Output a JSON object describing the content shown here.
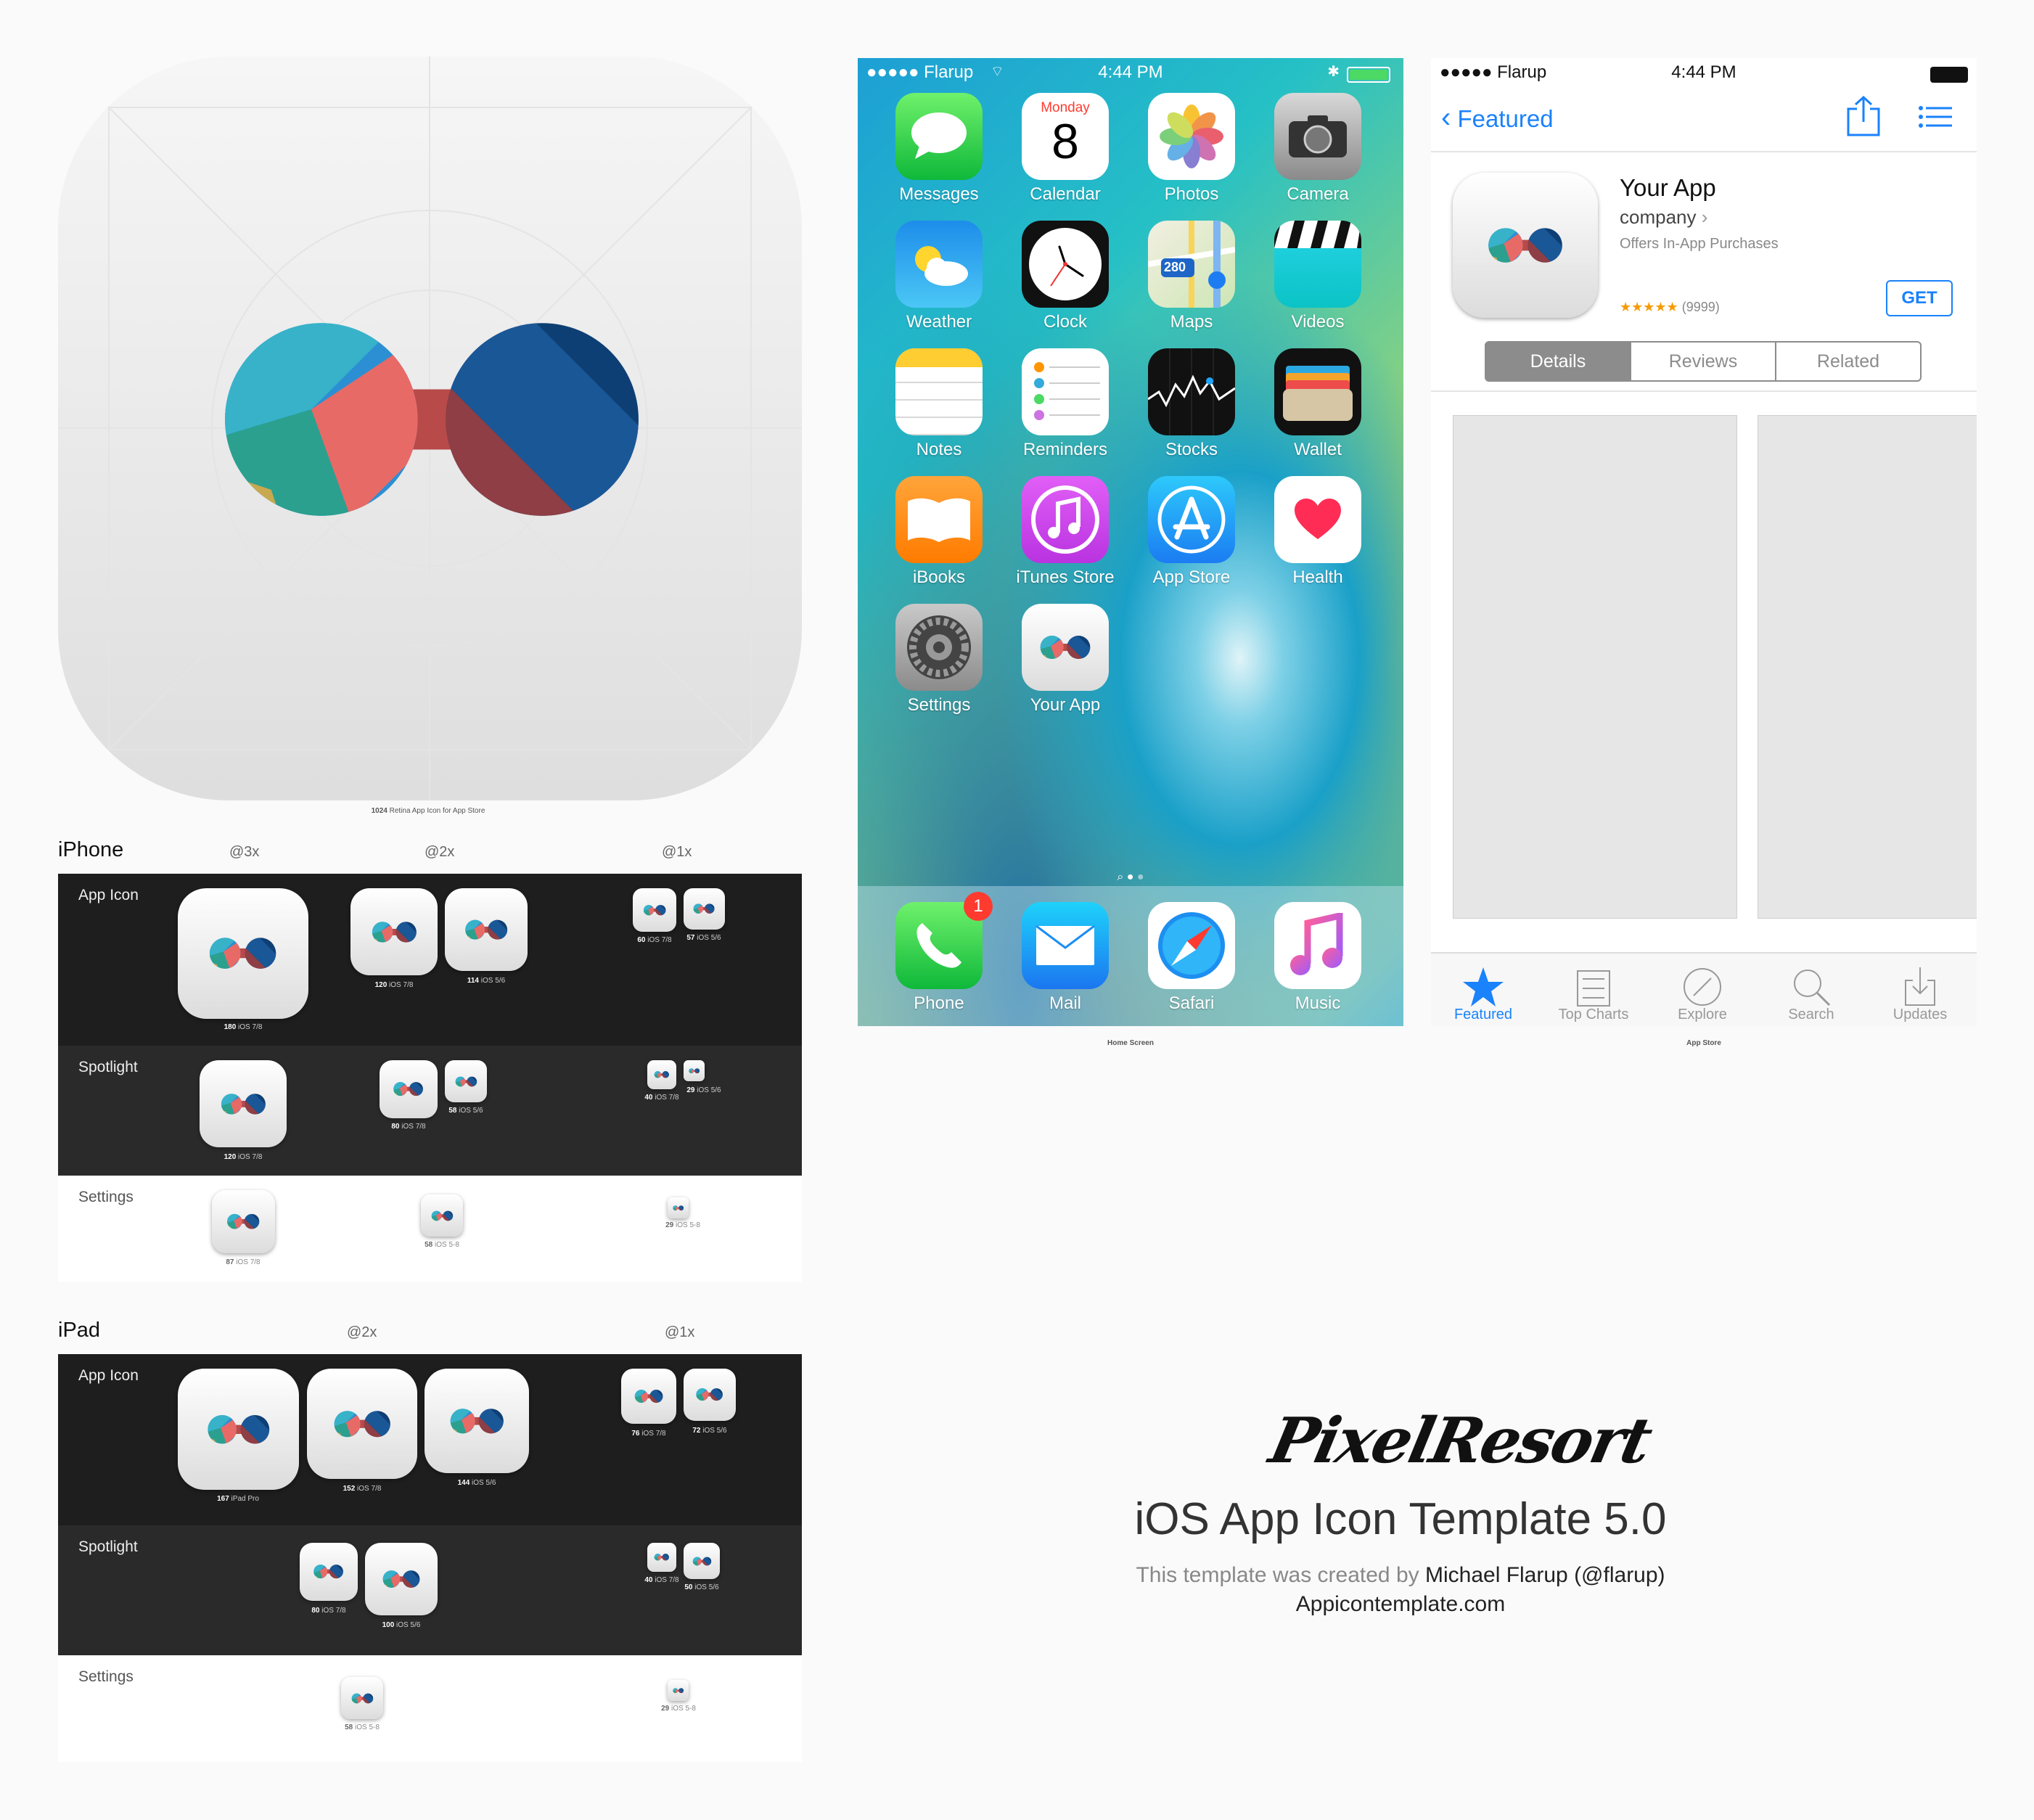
{
  "big_icon": {
    "caption_size": "1024",
    "caption_text": "Retina App Icon for App Store"
  },
  "iphone": {
    "title": "iPhone",
    "columns": [
      "@3x",
      "@2x",
      "@1x"
    ],
    "rows": [
      {
        "label": "App Icon",
        "items": [
          {
            "size": "180",
            "ver": "iOS 7/8"
          },
          {
            "size": "120",
            "ver": "iOS 7/8"
          },
          {
            "size": "114",
            "ver": "iOS 5/6"
          },
          {
            "size": "60",
            "ver": "iOS 7/8"
          },
          {
            "size": "57",
            "ver": "iOS 5/6"
          }
        ]
      },
      {
        "label": "Spotlight",
        "items": [
          {
            "size": "120",
            "ver": "iOS 7/8"
          },
          {
            "size": "80",
            "ver": "iOS 7/8"
          },
          {
            "size": "58",
            "ver": "iOS 5/6"
          },
          {
            "size": "40",
            "ver": "iOS 7/8"
          },
          {
            "size": "29",
            "ver": "iOS 5/6"
          }
        ]
      },
      {
        "label": "Settings",
        "items": [
          {
            "size": "87",
            "ver": "iOS 7/8"
          },
          {
            "size": "58",
            "ver": "iOS 5-8"
          },
          {
            "size": "29",
            "ver": "iOS 5-8"
          }
        ]
      }
    ]
  },
  "ipad": {
    "title": "iPad",
    "columns": [
      "@2x",
      "@1x"
    ],
    "rows": [
      {
        "label": "App Icon",
        "items": [
          {
            "size": "167",
            "ver": "iPad Pro"
          },
          {
            "size": "152",
            "ver": "iOS 7/8"
          },
          {
            "size": "144",
            "ver": "iOS 5/6"
          },
          {
            "size": "76",
            "ver": "iOS 7/8"
          },
          {
            "size": "72",
            "ver": "iOS 5/6"
          }
        ]
      },
      {
        "label": "Spotlight",
        "items": [
          {
            "size": "80",
            "ver": "iOS 7/8"
          },
          {
            "size": "100",
            "ver": "iOS 5/6"
          },
          {
            "size": "40",
            "ver": "iOS 7/8"
          },
          {
            "size": "50",
            "ver": "iOS 5/6"
          }
        ]
      },
      {
        "label": "Settings",
        "items": [
          {
            "size": "58",
            "ver": "iOS 5-8"
          },
          {
            "size": "29",
            "ver": "iOS 5-8"
          }
        ]
      }
    ]
  },
  "home_screen": {
    "carrier": "●●●●● Flarup",
    "time": "4:44 PM",
    "caption": "Home Screen",
    "apps": [
      {
        "name": "Messages",
        "icon": "messages-icon"
      },
      {
        "name": "Calendar",
        "icon": "calendar-icon",
        "day": "Monday",
        "date": "8"
      },
      {
        "name": "Photos",
        "icon": "photos-icon"
      },
      {
        "name": "Camera",
        "icon": "camera-icon"
      },
      {
        "name": "Weather",
        "icon": "weather-icon"
      },
      {
        "name": "Clock",
        "icon": "clock-icon"
      },
      {
        "name": "Maps",
        "icon": "maps-icon",
        "road": "280"
      },
      {
        "name": "Videos",
        "icon": "videos-icon"
      },
      {
        "name": "Notes",
        "icon": "notes-icon"
      },
      {
        "name": "Reminders",
        "icon": "reminders-icon"
      },
      {
        "name": "Stocks",
        "icon": "stocks-icon"
      },
      {
        "name": "Wallet",
        "icon": "wallet-icon"
      },
      {
        "name": "iBooks",
        "icon": "ibooks-icon"
      },
      {
        "name": "iTunes Store",
        "icon": "itunes-icon"
      },
      {
        "name": "App Store",
        "icon": "appstore-icon"
      },
      {
        "name": "Health",
        "icon": "health-icon"
      },
      {
        "name": "Settings",
        "icon": "settings-icon"
      },
      {
        "name": "Your App",
        "icon": "your-app-icon"
      }
    ],
    "dock": [
      {
        "name": "Phone",
        "icon": "phone-icon",
        "badge": "1"
      },
      {
        "name": "Mail",
        "icon": "mail-icon"
      },
      {
        "name": "Safari",
        "icon": "safari-icon"
      },
      {
        "name": "Music",
        "icon": "music-icon"
      }
    ]
  },
  "app_store": {
    "carrier": "●●●●● Flarup",
    "time": "4:44 PM",
    "back_label": "Featured",
    "app_name": "Your App",
    "company": "company",
    "iap": "Offers In-App Purchases",
    "get_label": "GET",
    "stars": "★★★★★",
    "rating_count": "(9999)",
    "segments": [
      "Details",
      "Reviews",
      "Related"
    ],
    "tabs": [
      "Featured",
      "Top Charts",
      "Explore",
      "Search",
      "Updates"
    ],
    "caption": "App Store",
    "accent": "#1a82fb"
  },
  "footer": {
    "brand": "PixelResort",
    "title": "iOS App Icon Template 5.0",
    "credit_prefix": "This template was created by",
    "credit_name": "Michael Flarup (@flarup)",
    "site": "Appicontemplate.com"
  }
}
